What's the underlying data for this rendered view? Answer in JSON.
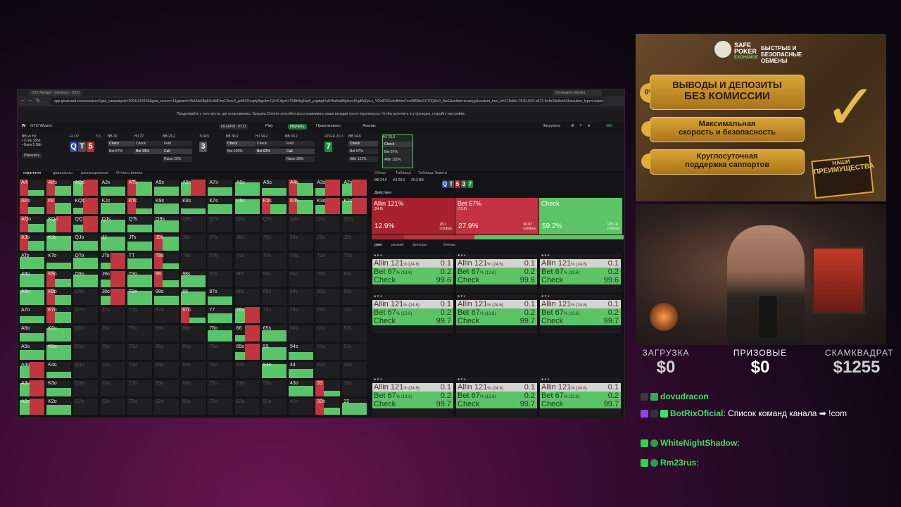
{
  "browser": {
    "tab_title": "GTO Wizard - Solutions - GTO",
    "tab_right": "Отправить Gemini",
    "url": "app.gtowizard.com/solutions?gad_campaignid=20911500155&gad_source=1&gbraid=0AAAAABq9Xv4MDnoCAenJf_gcBtCRxxpfy8tgclid=Cj04CAjw4cTSBhAqEiwA_yxgdqdXaKHkz5w88glmoUKg80qFpLz_YOz9C6EshefhtwnTzw9859bcC6T0QAvD_BwE&soltab=strategy&custom_tree_id=278af8e-7849-4f10-a572-9c4b18e8cb43&solution_type=custom&gmfs_solution_t...",
    "notice": "Продолжайте с того места, где остановились. Браузер Chrome способен восстанавливать ваши вкладки после перезапуска. Чтобы включить эту функцию, откройте настройки."
  },
  "app": {
    "logo": "W",
    "name": "GTO Wizard",
    "mode_nlh": "NLH/PR",
    "mode_plo": "PLO",
    "nav": [
      "Play",
      "Изучить",
      "Практиковать",
      "Анализ"
    ],
    "upload": "Загрузить",
    "balance": "500"
  },
  "strip": {
    "spot": "BB vs HJ",
    "stack": "• Стек 33bb",
    "bank": "• Банк 5.5bb",
    "change": "Изменить",
    "flop_label": "FLOP",
    "flop_pot": "5.5",
    "turn_label": "TURN",
    "turn_pot": "10.3",
    "river_label": "RIVER",
    "river_pot": "20.3",
    "nodes": [
      {
        "pos": "BB",
        "stack": "32",
        "pot": "$10",
        "rows": [
          "Check",
          "Bet 67%"
        ],
        "sel": 0
      },
      {
        "pos": "HJ",
        "stack": "27",
        "pot": "$10",
        "rows": [
          "Check",
          "Bet 33%"
        ],
        "sel": 1
      },
      {
        "pos": "BB",
        "stack": "23.2",
        "pot": "$10",
        "rows": [
          "Fold",
          "Call",
          "Raise 25%"
        ],
        "sel": 1
      },
      {
        "pos": "BB",
        "stack": "30.2",
        "pot": "$10",
        "rows": [
          "Check",
          "Bet 100%"
        ],
        "sel": 0
      },
      {
        "pos": "HJ",
        "stack": "34.2",
        "pot": "$15",
        "rows": [
          "Check",
          "Bet 62%"
        ],
        "sel": 1
      },
      {
        "pos": "BB",
        "stack": "30.2",
        "pot": "$10",
        "rows": [
          "Fold",
          "Call",
          "Raise 28%"
        ],
        "sel": 1
      },
      {
        "pos": "BB",
        "stack": "24.6",
        "pot": "$10",
        "rows": [
          "Check",
          "Bet 67%",
          "Allin 121%"
        ],
        "sel": 0
      },
      {
        "pos": "HJ",
        "stack": "28.6",
        "pot": "$15",
        "rows": [
          "Check",
          "Bet 67%",
          "Allin 121%"
        ],
        "sel": 0
      }
    ],
    "flop_cards": [
      "Q",
      "T",
      "5"
    ],
    "turn_card": "3",
    "river_card": "7"
  },
  "grid_tabs": [
    "стратегия",
    "диапазоны",
    "распределение",
    "Отчеты флопа"
  ],
  "grid": [
    [
      "AA",
      "AKs",
      "AQs",
      "AJs",
      "ATs",
      "A9s",
      "A8s",
      "A7s",
      "A6s",
      "A5s",
      "A4s",
      "A3s",
      "A2s"
    ],
    [
      "AKo",
      "KK",
      "KQs",
      "KJs",
      "KTs",
      "K9s",
      "K8s",
      "K7s",
      "K6s",
      "K5s",
      "K4s",
      "K3s",
      "K2s"
    ],
    [
      "AQo",
      "KQo",
      "QQ",
      "QJs",
      "QTs",
      "Q9s",
      "Q8s",
      "Q7s",
      "Q6s",
      "Q5s",
      "Q4s",
      "Q3s",
      "Q2s"
    ],
    [
      "AJo",
      "KJo",
      "QJo",
      "JJ",
      "JTs",
      "J9s",
      "J8s",
      "J7s",
      "J6s",
      "J5s",
      "J4s",
      "J3s",
      "J2s"
    ],
    [
      "ATo",
      "KTo",
      "QTo",
      "JTo",
      "TT",
      "T9s",
      "T8s",
      "T7s",
      "T6s",
      "T5s",
      "T4s",
      "T3s",
      "T2s"
    ],
    [
      "A9o",
      "K9o",
      "Q9o",
      "J9o",
      "T9o",
      "99",
      "98s",
      "97s",
      "96s",
      "95s",
      "94s",
      "93s",
      "92s"
    ],
    [
      "A8o",
      "K8o",
      "Q8o",
      "J8o",
      "T8o",
      "98o",
      "88",
      "87s",
      "86s",
      "85s",
      "84s",
      "83s",
      "82s"
    ],
    [
      "A7o",
      "K7o",
      "Q7o",
      "J7o",
      "T7o",
      "97o",
      "87o",
      "77",
      "76s",
      "75s",
      "74s",
      "73s",
      "72s"
    ],
    [
      "A6o",
      "K6o",
      "Q6o",
      "J6o",
      "T6o",
      "96o",
      "86o",
      "76o",
      "66",
      "65s",
      "64s",
      "63s",
      "62s"
    ],
    [
      "A5o",
      "K5o",
      "Q5o",
      "J5o",
      "T5o",
      "95o",
      "85o",
      "75o",
      "65o",
      "55",
      "54s",
      "53s",
      "52s"
    ],
    [
      "A4o",
      "K4o",
      "Q4o",
      "J4o",
      "T4o",
      "94o",
      "84o",
      "74o",
      "64o",
      "54o",
      "44",
      "43s",
      "42s"
    ],
    [
      "A3o",
      "K3o",
      "Q3o",
      "J3o",
      "T3o",
      "93o",
      "83o",
      "73o",
      "63o",
      "53o",
      "43o",
      "33",
      "32s"
    ],
    [
      "A2o",
      "K2o",
      "Q2o",
      "J2o",
      "T2o",
      "92o",
      "82o",
      "72o",
      "62o",
      "52o",
      "42o",
      "32o",
      "22"
    ]
  ],
  "panel": {
    "tabs": [
      "Обзор",
      "Таблица",
      "Таблица Эквити"
    ],
    "bb": "BB 24.6",
    "hj": "HJ 28.6",
    "pot": "20.3 BB",
    "actions_label": "Действия",
    "actions": [
      {
        "name": "Allin 121%",
        "sub": "(24.6)",
        "pct": "12.9%",
        "count": "28.2",
        "count_label": "combos",
        "color": "#a8222d"
      },
      {
        "name": "Bet 67%",
        "sub": "(13.6)",
        "pct": "27.9%",
        "count": "60.87",
        "count_label": "combos",
        "color": "#c23240"
      },
      {
        "name": "Check",
        "sub": "",
        "pct": "59.2%",
        "count": "129.16",
        "count_label": "combos",
        "color": "#5cc466"
      }
    ],
    "sub_tabs": [
      "руки",
      "резюме",
      "фильтры",
      "Кикеры"
    ],
    "combo_lines": [
      {
        "name": "Allin 121",
        "size": "% (24.6)",
        "value": "0.1"
      },
      {
        "name": "Bet 67",
        "size": "% (13.6)",
        "value": "0.2"
      },
      {
        "name": "Check",
        "size": "",
        "value": "99.6"
      }
    ],
    "combo_lines_b": [
      {
        "name": "Allin 121",
        "size": "% (24.6)",
        "value": "0.1"
      },
      {
        "name": "Bet 67",
        "size": "% (13.6)",
        "value": "0.2"
      },
      {
        "name": "Check",
        "size": "",
        "value": "99.7"
      }
    ]
  },
  "ad": {
    "brand_line1": "SAFE",
    "brand_line2": "POKER",
    "brand_line3": "EXCHANGE",
    "tagline": "БЫСТРЫЕ И БЕЗОПАСНЫЕ ОБМЕНЫ",
    "zero": "0%",
    "pill1_a": "ВЫВОДЫ И ДЕПОЗИТЫ",
    "pill1_b": "БЕЗ КОМИССИИ",
    "pill2_a": "Максимальная",
    "pill2_b": "скорость и безопасность",
    "pill3_a": "Круглосуточная",
    "pill3_b": "поддержка саппортов",
    "stamp_a": "НАШИ",
    "stamp_b": "ПРЕИМУЩЕСТВА"
  },
  "stats": [
    {
      "title": "ЗАГРУЗКА",
      "value": "$0"
    },
    {
      "title": "ПРИЗОВЫЕ",
      "value": "$0"
    },
    {
      "title": "СКАМКВАДРАТ",
      "value": "$1255"
    }
  ],
  "chat": [
    {
      "user": "dovudracon",
      "text": ""
    },
    {
      "user": "BotRixOficial",
      "text": "Список команд канала ➡ !com"
    },
    {
      "user": "WhiteNightShadow",
      "text": ""
    },
    {
      "user": "Rm23rus",
      "text": ""
    }
  ]
}
